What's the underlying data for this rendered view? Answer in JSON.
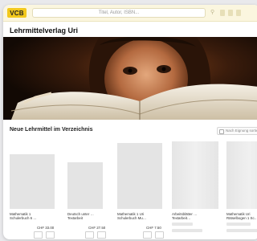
{
  "header": {
    "logo_text": "VCB",
    "search_text": "Titel, Autor, ISBN...",
    "accent_color": "#f2c81d",
    "bar_color": "#fbf6df"
  },
  "page": {
    "title": "Lehrmittelverlag Uri",
    "hero_image": "Kind liest ein aufgeschlagenes Buch"
  },
  "section": {
    "title": "Neue Lehrmittel im Verzeichnis",
    "sort_label": "Nach Eignung sortieren"
  },
  "books": [
    {
      "title": "Mathematik 1\nSchulerbuch 6 …",
      "price": "CHF 33.00",
      "loaded": true
    },
    {
      "title": "Deutsch unter …\nTextarbeit",
      "price": "CHF 27.50",
      "loaded": true
    },
    {
      "title": "Mathematik 1 Uri\nSchulerbuch Mu…",
      "price": "CHF 7.50",
      "loaded": true
    },
    {
      "title": "Arbeitsblätter …\nTextarbeit…",
      "price": "",
      "loaded": false
    },
    {
      "title": "Mathematik Uri\nRätselbogen 1 Sc…",
      "price": "",
      "loaded": false
    }
  ]
}
